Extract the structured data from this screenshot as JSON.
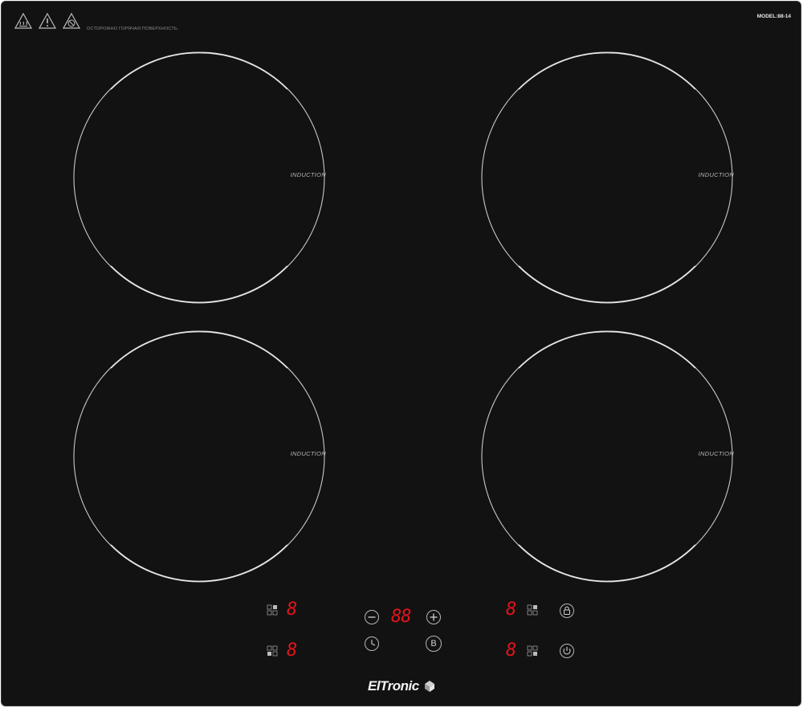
{
  "header": {
    "warning_text": "ОСТОРОЖНО ГОРЯЧАЯ ПОВЕРХНОСТЬ.",
    "model_text": "MODEL:88-14",
    "warning_icons": [
      "hot-surface-icon",
      "caution-icon",
      "no-touch-icon"
    ]
  },
  "zones": [
    {
      "label": "INDUCTION"
    },
    {
      "label": "INDUCTION"
    },
    {
      "label": "INDUCTION"
    },
    {
      "label": "INDUCTION"
    }
  ],
  "controls": {
    "zone_rear_left_level": "8",
    "zone_front_left_level": "8",
    "timer_display": "88",
    "zone_rear_right_level": "8",
    "zone_front_right_level": "8",
    "minus_icon": "minus-icon",
    "plus_icon": "plus-icon",
    "timer_icon": "clock-icon",
    "boost_label": "B",
    "lock_icon": "lock-icon",
    "power_icon": "power-icon"
  },
  "brand": {
    "name": "ElTronic"
  },
  "colors": {
    "panel": "#121212",
    "display": "#e2141a",
    "ring": "#c8c8c8"
  }
}
